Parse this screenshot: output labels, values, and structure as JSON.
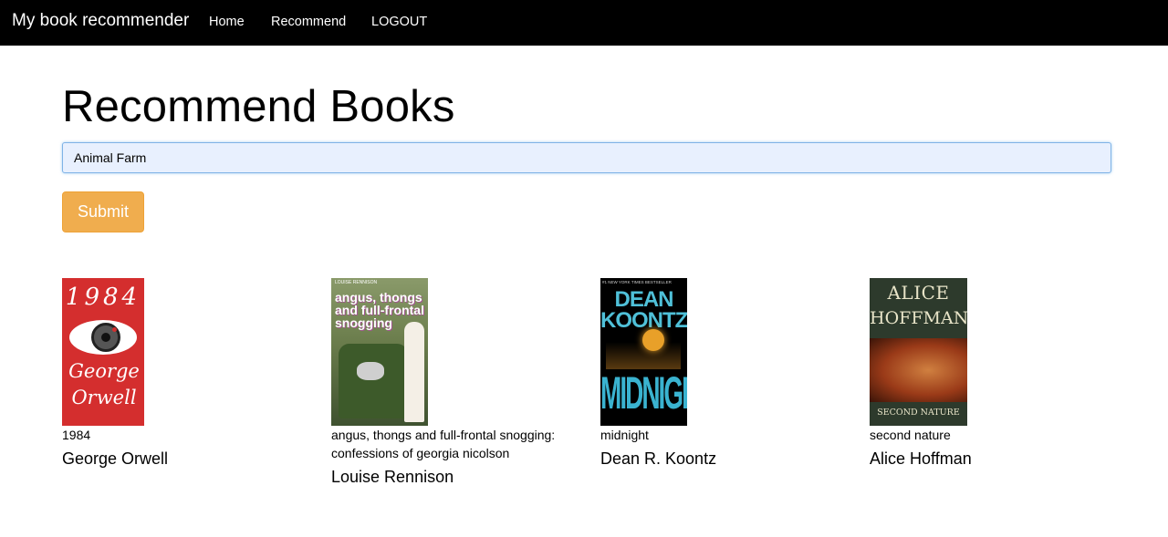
{
  "nav": {
    "brand": "My book recommender",
    "links": [
      "Home",
      "Recommend",
      "LOGOUT"
    ]
  },
  "page": {
    "title": "Recommend Books"
  },
  "search": {
    "value": "Animal Farm"
  },
  "submit_label": "Submit",
  "books": [
    {
      "title": "1984",
      "author": "George Orwell",
      "cover": {
        "title_text": "1984",
        "author_text": "George Orwell",
        "color": "#d42e2e"
      }
    },
    {
      "title": "angus, thongs and full-frontal snogging: confessions of georgia nicolson",
      "author": "Louise Rennison",
      "cover": {
        "top_text": "LOUISE RENNISON",
        "title_text": "angus, thongs and full-frontal snogging",
        "color": "#6d7f4e"
      }
    },
    {
      "title": "midnight",
      "author": "Dean R. Koontz",
      "cover": {
        "top_text": "#1 NEW YORK TIMES BESTSELLER",
        "title_text": "MIDNIGHT",
        "author_text": "DEAN KOONTZ",
        "color": "#000000"
      }
    },
    {
      "title": "second nature",
      "author": "Alice Hoffman",
      "cover": {
        "author_line1": "ALICE",
        "author_line2": "HOFFMAN",
        "title_text": "SECOND NATURE",
        "color": "#2d3a2c"
      }
    }
  ]
}
